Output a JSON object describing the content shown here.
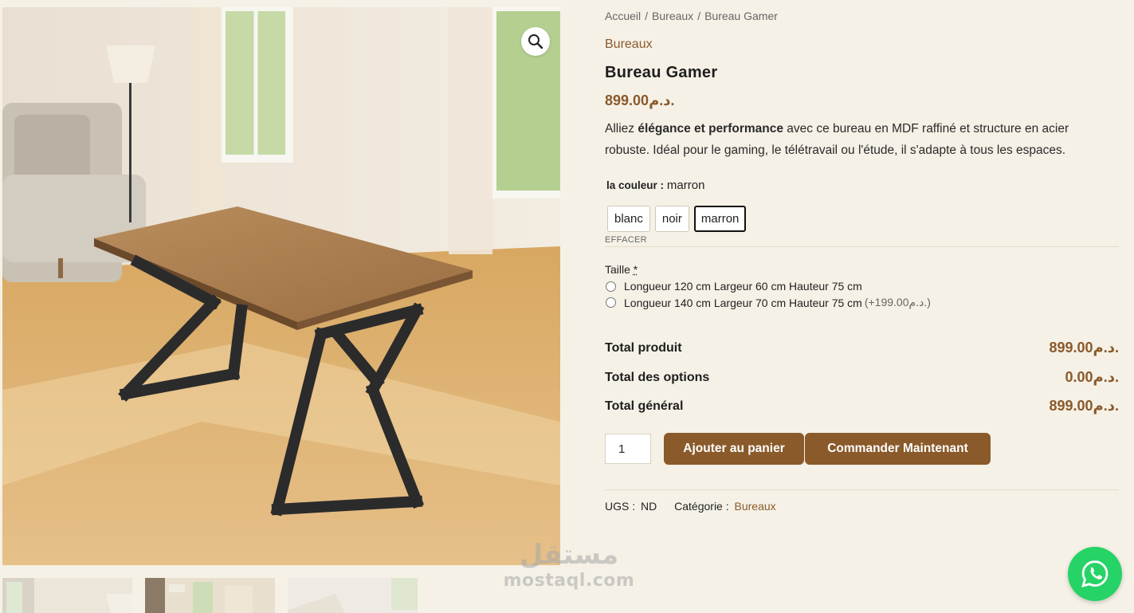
{
  "breadcrumb": {
    "home": "Accueil",
    "category": "Bureaux",
    "current": "Bureau Gamer",
    "separator": "/"
  },
  "product": {
    "category": "Bureaux",
    "title": "Bureau Gamer",
    "price": "899.00د.م.",
    "description": {
      "pre": "Alliez ",
      "bold": "élégance et performance",
      "post": " avec ce bureau en MDF raffiné et structure en acier robuste. Idéal pour le gaming, le télétravail ou l'étude, il s'adapte à tous les espaces."
    }
  },
  "color_attr": {
    "label": "la couleur :",
    "selected": "marron",
    "options": [
      "blanc",
      "noir",
      "marron"
    ],
    "clear": "EFFACER"
  },
  "size_attr": {
    "label": "Taille",
    "required_mark": "*",
    "options": [
      {
        "text": "Longueur 120 cm Largeur 60 cm Hauteur 75 cm",
        "extra": ""
      },
      {
        "text": "Longueur 140 cm Largeur 70 cm Hauteur 75 cm",
        "extra": "(+199.00د.م.)"
      }
    ]
  },
  "totals": {
    "product_label": "Total produit",
    "product_value": "899.00د.م.",
    "options_label": "Total des options",
    "options_value": "0.00د.م.",
    "grand_label": "Total général",
    "grand_value": "899.00د.م."
  },
  "cart": {
    "quantity": "1",
    "add_label": "Ajouter au panier",
    "order_label": "Commander Maintenant"
  },
  "meta": {
    "sku_label": "UGS :",
    "sku_value": "ND",
    "category_label": "Catégorie :",
    "category_value": "Bureaux"
  },
  "watermark": {
    "arabic": "مستقل",
    "latin": "mostaql.com"
  },
  "icons": {
    "zoom": "magnifier-icon",
    "chat": "whatsapp-icon"
  },
  "colors": {
    "accent": "#8a5a2b",
    "background": "#f5f1e6",
    "whatsapp": "#25d366"
  }
}
